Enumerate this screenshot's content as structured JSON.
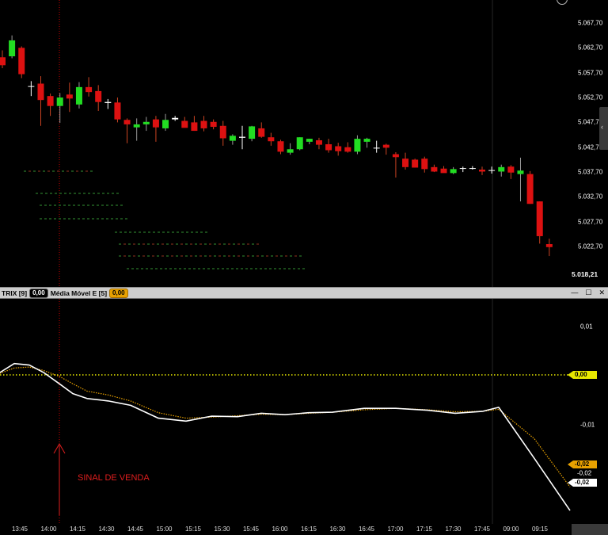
{
  "price_axis": {
    "labels": [
      "5.067,70",
      "5.062,70",
      "5.057,70",
      "5.052,70",
      "5.047,70",
      "5.042,70",
      "5.037,70",
      "5.032,70",
      "5.027,70",
      "5.022,70"
    ],
    "last_price": "5.018,21"
  },
  "indicator_bar": {
    "trix_label": "TRIX [9]",
    "trix_value": "0,00",
    "ema_label": "Média Móvel E [5]",
    "ema_value": "0,00",
    "minimize_icon": "minimize-icon",
    "maximize_icon": "maximize-icon",
    "close_icon": "close-icon"
  },
  "indicator_axis": {
    "labels": [
      "0,01",
      "-0,01"
    ],
    "zero_flag": "0,00",
    "ema_flag": "-0,02",
    "mid_label": "-0,02",
    "trix_flag": "-0,02"
  },
  "time_axis": {
    "labels": [
      "13:45",
      "14:00",
      "14:15",
      "14:30",
      "14:45",
      "15:00",
      "15:15",
      "15:30",
      "15:45",
      "16:00",
      "16:15",
      "16:30",
      "16:45",
      "17:00",
      "17:15",
      "17:30",
      "17:45",
      "09:00",
      "09:15"
    ]
  },
  "annotation": {
    "signal_text": "SINAL DE VENDA"
  },
  "colors": {
    "bull": "#22dd22",
    "bear": "#dd1111",
    "trix_line": "#ffffff",
    "ema_line": "#e8a100",
    "zero_line": "#e8e800",
    "signal": "#e01e1e"
  },
  "chart_data": [
    {
      "type": "candlestick",
      "ylim": [
        5017.0,
        5072.0
      ],
      "x": [
        "13:40",
        "13:45",
        "13:50",
        "13:55",
        "14:00",
        "14:05",
        "14:10",
        "14:15",
        "14:20",
        "14:25",
        "14:30",
        "14:35",
        "14:40",
        "14:45",
        "14:50",
        "14:55",
        "15:00",
        "15:05",
        "15:10",
        "15:15",
        "15:20",
        "15:25",
        "15:30",
        "15:35",
        "15:40",
        "15:45",
        "15:50",
        "15:55",
        "16:00",
        "16:05",
        "16:10",
        "16:15",
        "16:20",
        "16:25",
        "16:30",
        "16:35",
        "16:40",
        "16:45",
        "16:50",
        "16:55",
        "17:00",
        "17:05",
        "17:10",
        "17:15",
        "17:20",
        "17:25",
        "17:30",
        "17:35",
        "17:40",
        "17:45",
        "17:50",
        "17:55",
        "09:00",
        "09:05",
        "09:10",
        "09:15",
        "09:20",
        "09:25",
        "09:30"
      ],
      "ohlc": [
        [
          5060.8,
          5062.2,
          5058.6,
          5059.2
        ],
        [
          5061.0,
          5065.2,
          5060.6,
          5064.2
        ],
        [
          5062.7,
          5063.0,
          5056.6,
          5057.4
        ],
        [
          5055.0,
          5056.0,
          5053.0,
          5055.0
        ],
        [
          5055.5,
          5057.0,
          5047.0,
          5052.2
        ],
        [
          5053.0,
          5053.5,
          5049.0,
          5051.0
        ],
        [
          5051.0,
          5053.6,
          5047.6,
          5052.7
        ],
        [
          5053.3,
          5055.7,
          5049.8,
          5052.5
        ],
        [
          5051.3,
          5055.8,
          5050.5,
          5054.8
        ],
        [
          5054.8,
          5056.8,
          5052.9,
          5053.8
        ],
        [
          5054.0,
          5055.2,
          5050.0,
          5051.8
        ],
        [
          5051.8,
          5052.4,
          5050.4,
          5051.6
        ],
        [
          5051.7,
          5052.7,
          5047.7,
          5048.3
        ],
        [
          5048.2,
          5048.5,
          5043.5,
          5047.3
        ],
        [
          5046.7,
          5048.5,
          5044.0,
          5047.3
        ],
        [
          5047.3,
          5048.8,
          5046.0,
          5047.8
        ],
        [
          5048.3,
          5049.0,
          5043.8,
          5046.7
        ],
        [
          5046.5,
          5049.4,
          5046.0,
          5048.2
        ],
        [
          5048.6,
          5049.0,
          5048.0,
          5048.3
        ],
        [
          5048.0,
          5048.8,
          5046.8,
          5046.6
        ],
        [
          5047.7,
          5049.0,
          5046.0,
          5046.0
        ],
        [
          5048.0,
          5049.0,
          5045.9,
          5046.5
        ],
        [
          5047.8,
          5048.3,
          5046.3,
          5046.8
        ],
        [
          5047.0,
          5048.0,
          5043.0,
          5044.5
        ],
        [
          5044.0,
          5045.3,
          5043.2,
          5045.0
        ],
        [
          5044.6,
          5047.0,
          5042.3,
          5044.8
        ],
        [
          5044.4,
          5047.0,
          5043.9,
          5046.9
        ],
        [
          5046.5,
          5047.7,
          5044.6,
          5044.8
        ],
        [
          5044.7,
          5045.6,
          5043.0,
          5043.9
        ],
        [
          5043.9,
          5044.2,
          5041.3,
          5041.8
        ],
        [
          5041.6,
          5043.5,
          5041.2,
          5042.3
        ],
        [
          5042.3,
          5044.7,
          5042.1,
          5044.7
        ],
        [
          5043.8,
          5044.4,
          5043.3,
          5044.4
        ],
        [
          5044.1,
          5044.6,
          5042.3,
          5043.2
        ],
        [
          5043.3,
          5044.4,
          5041.6,
          5042.1
        ],
        [
          5042.9,
          5043.6,
          5041.0,
          5041.9
        ],
        [
          5042.7,
          5043.7,
          5041.6,
          5041.8
        ],
        [
          5041.8,
          5045.1,
          5041.3,
          5044.4
        ],
        [
          5043.8,
          5044.6,
          5042.6,
          5044.4
        ],
        [
          5042.6,
          5044.0,
          5041.6,
          5042.6
        ],
        [
          5043.2,
          5043.4,
          5041.2,
          5042.6
        ],
        [
          5041.3,
          5041.7,
          5036.6,
          5040.7
        ],
        [
          5040.4,
          5041.6,
          5038.2,
          5038.7
        ],
        [
          5040.2,
          5040.4,
          5038.6,
          5038.6
        ],
        [
          5040.4,
          5040.8,
          5037.6,
          5038.3
        ],
        [
          5038.7,
          5039.2,
          5037.7,
          5037.8
        ],
        [
          5038.4,
          5038.9,
          5037.6,
          5037.5
        ],
        [
          5037.5,
          5038.7,
          5037.3,
          5038.3
        ],
        [
          5038.5,
          5038.8,
          5037.7,
          5038.5
        ],
        [
          5038.4,
          5038.9,
          5038.2,
          5038.5
        ],
        [
          5038.2,
          5038.8,
          5037.1,
          5037.8
        ],
        [
          5038.1,
          5038.8,
          5037.4,
          5038.1
        ],
        [
          5037.8,
          5039.2,
          5036.8,
          5038.7
        ],
        [
          5038.8,
          5039.1,
          5036.3,
          5037.6
        ],
        [
          5037.3,
          5040.6,
          5031.8,
          5038.0
        ],
        [
          5037.3,
          5037.9,
          5031.3,
          5031.3
        ],
        [
          5031.8,
          5031.8,
          5023.3,
          5024.8
        ],
        [
          5023.2,
          5024.3,
          5020.8,
          5022.6
        ]
      ]
    },
    {
      "type": "line",
      "ylim": [
        -0.038,
        0.016
      ],
      "x": [
        "13:40",
        "13:45",
        "13:50",
        "13:55",
        "14:00",
        "14:05",
        "14:10",
        "14:15",
        "14:30",
        "14:45",
        "15:00",
        "15:15",
        "15:30",
        "15:45",
        "16:00",
        "16:15",
        "16:30",
        "16:45",
        "17:00",
        "17:15",
        "17:30",
        "17:45",
        "09:00",
        "09:15",
        "09:30"
      ],
      "series": [
        {
          "name": "TRIX [9]",
          "values": [
            0.0005,
            0.0023,
            0.002,
            0.0005,
            -0.0018,
            -0.0038,
            -0.0048,
            -0.0053,
            -0.0062,
            -0.0088,
            -0.0094,
            -0.0084,
            -0.0085,
            -0.0078,
            -0.0081,
            -0.0077,
            -0.0076,
            -0.0068,
            -0.0068,
            -0.0072,
            -0.0078,
            -0.0074,
            -0.0066,
            -0.017,
            -0.0276
          ]
        },
        {
          "name": "Média Móvel E [5]",
          "values": [
            0.0003,
            0.0014,
            0.0016,
            0.0009,
            -0.0003,
            -0.0018,
            -0.0033,
            -0.0041,
            -0.0053,
            -0.0077,
            -0.0088,
            -0.0086,
            -0.0083,
            -0.008,
            -0.0081,
            -0.0078,
            -0.0076,
            -0.0071,
            -0.0068,
            -0.0071,
            -0.0075,
            -0.0074,
            -0.007,
            -0.013,
            -0.0228
          ]
        }
      ]
    }
  ]
}
